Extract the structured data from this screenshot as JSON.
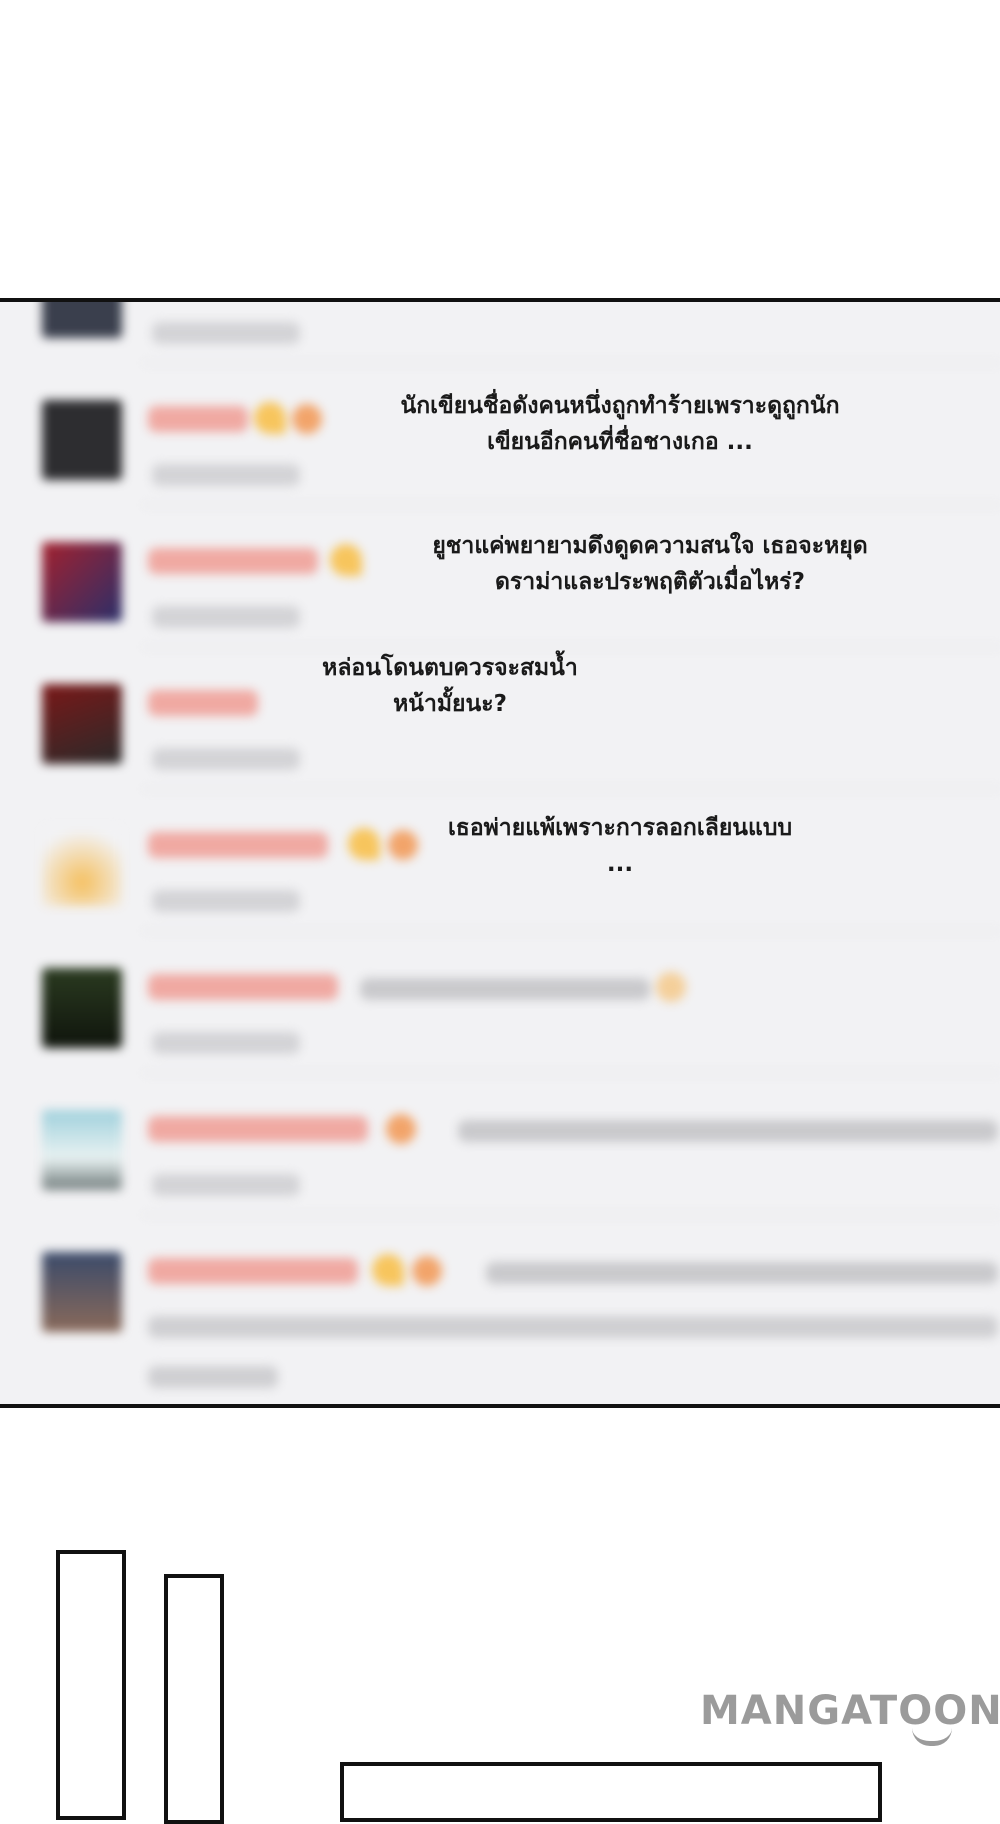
{
  "captions": [
    {
      "id": "caption-1",
      "text": "นักเขียนชื่อดังคนหนึ่งถูกทำร้ายเพราะดูถูกนัก\nเขียนอีกคนที่ชื่อชางเกอ ..."
    },
    {
      "id": "caption-2",
      "text": "ยูชาแค่พยายามดึงดูดความสนใจ เธอจะหยุด\nดราม่าและประพฤติตัวเมื่อไหร่?"
    },
    {
      "id": "caption-3",
      "text": "หล่อนโดนตบควรจะสมน้ำ\nหน้ามั้ยนะ?"
    },
    {
      "id": "caption-4",
      "text": "เธอพ่ายแพ้เพราะการลอกเลียนแบบ\n..."
    }
  ],
  "watermark": {
    "text": "MANGATOON"
  },
  "colors": {
    "page": "#ffffff",
    "panel_bg": "#f2f2f4",
    "border": "#111111",
    "username_pink": "#f0a9a2",
    "watermark_gray": "#9b9b9b"
  },
  "icons": {
    "smile": "smile-curve-icon"
  }
}
